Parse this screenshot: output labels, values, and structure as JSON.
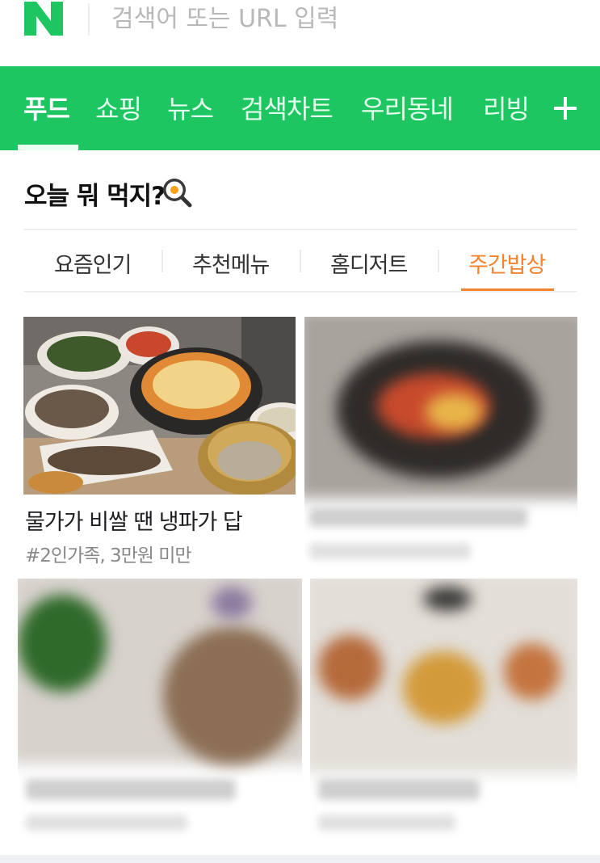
{
  "search": {
    "placeholder": "검색어 또는 URL 입력"
  },
  "nav": {
    "items": [
      {
        "label": "푸드",
        "active": true
      },
      {
        "label": "쇼핑"
      },
      {
        "label": "뉴스"
      },
      {
        "label": "검색차트"
      },
      {
        "label": "우리동네"
      },
      {
        "label": "리빙"
      }
    ],
    "add_icon": "plus-icon"
  },
  "section": {
    "title": "오늘 뭐 먹지?",
    "icon": "frying-pan-egg-icon"
  },
  "subtabs": [
    {
      "label": "요즘인기"
    },
    {
      "label": "추천메뉴"
    },
    {
      "label": "홈디저트"
    },
    {
      "label": "주간밥상",
      "active": true
    }
  ],
  "cards": [
    {
      "title": "물가가 비쌀 땐 냉파가 답",
      "tag": "#2인가족, 3만원 미만"
    }
  ],
  "colors": {
    "brand_green": "#1ec662",
    "accent_orange": "#f5822c"
  }
}
